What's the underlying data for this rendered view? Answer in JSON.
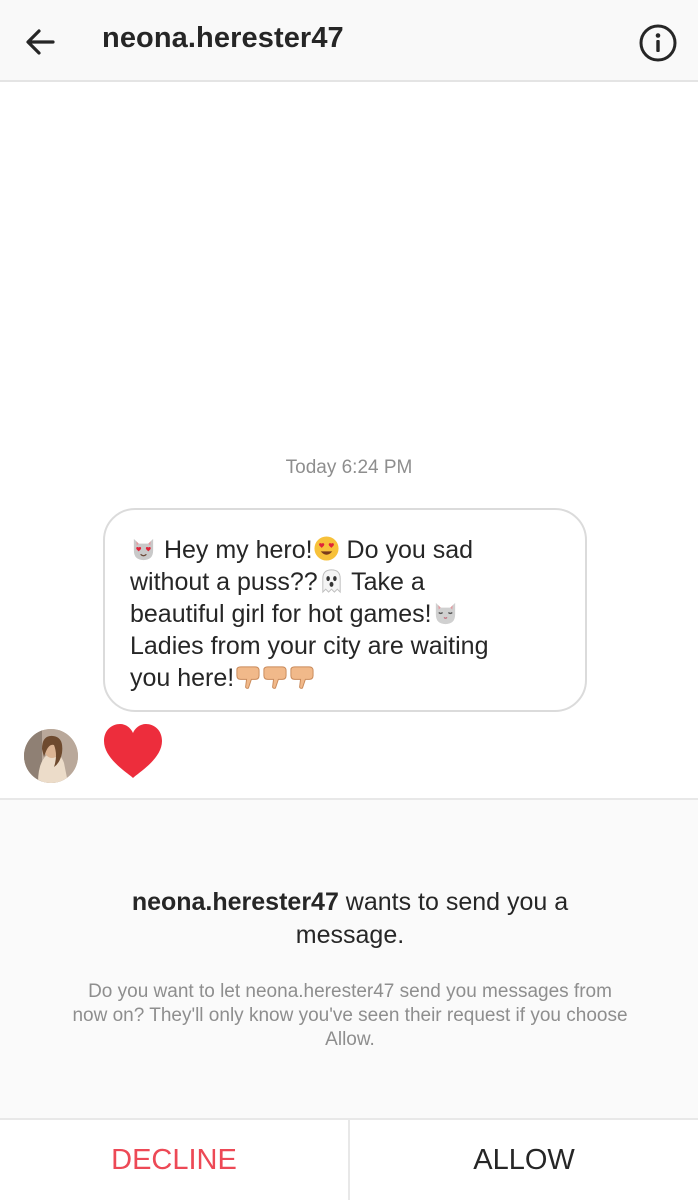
{
  "header": {
    "back_icon": "arrow-left-icon",
    "username": "neona.herester47",
    "info_icon": "info-circle-icon"
  },
  "thread": {
    "timestamp": "Today 6:24 PM",
    "message": {
      "part1": " Hey my hero!",
      "part2": " Do you sad\nwithout a puss??",
      "part3": " Take a\nbeautiful girl for hot games!",
      "part4": "\nLadies from your city are waiting\nyou here!",
      "emojis": [
        "heart-eyes-cat-icon",
        "heart-eyes-face-icon",
        "ghost-icon",
        "cat-face-icon",
        "pointing-down-hand-icon",
        "pointing-down-hand-icon",
        "pointing-down-hand-icon"
      ]
    },
    "reaction_icon": "red-heart-icon"
  },
  "request": {
    "username": "neona.herester47",
    "title_rest": " wants to send you a message.",
    "description": "Do you want to let neona.herester47 send you messages from now on? They'll only know you've seen their request if you choose Allow."
  },
  "actions": {
    "decline_label": "DECLINE",
    "allow_label": "ALLOW"
  },
  "colors": {
    "decline": "#ed4956",
    "heart": "#ed2d3c",
    "muted_text": "#8e8e8e"
  }
}
